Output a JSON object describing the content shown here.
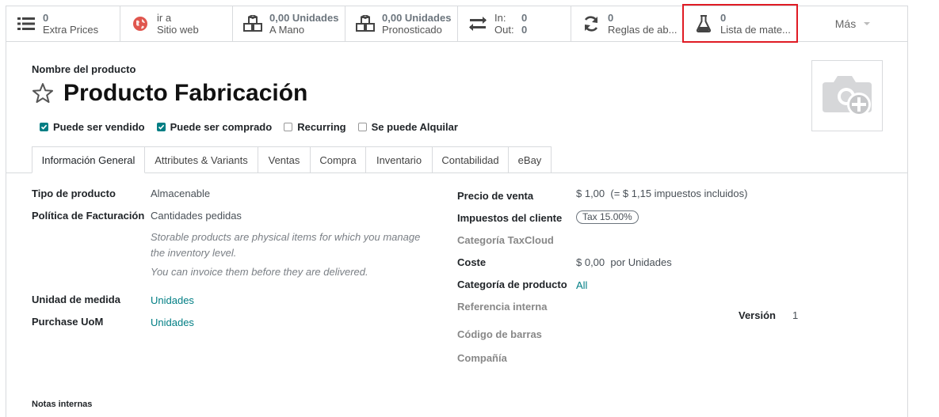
{
  "smart_buttons": {
    "extra_prices": {
      "value": "0",
      "label": "Extra Prices"
    },
    "website": {
      "value": "ir a",
      "label": "Sitio web"
    },
    "on_hand": {
      "value": "0,00 Unidades",
      "label": "A Mano"
    },
    "forecast": {
      "value": "0,00 Unidades",
      "label": "Pronosticado"
    },
    "in_out": {
      "in_label": "In:",
      "in_value": "0",
      "out_label": "Out:",
      "out_value": "0"
    },
    "reorder_rules": {
      "value": "0",
      "label": "Reglas de ab..."
    },
    "bom": {
      "value": "0",
      "label": "Lista de mate..."
    },
    "more": "Más"
  },
  "product": {
    "name_label": "Nombre del producto",
    "title": "Producto Fabricación"
  },
  "checkboxes": [
    {
      "label": "Puede ser vendido",
      "checked": true
    },
    {
      "label": "Puede ser comprado",
      "checked": true
    },
    {
      "label": "Recurring",
      "checked": false
    },
    {
      "label": "Se puede Alquilar",
      "checked": false
    }
  ],
  "tabs": [
    "Información General",
    "Attributes & Variants",
    "Ventas",
    "Compra",
    "Inventario",
    "Contabilidad",
    "eBay"
  ],
  "left_fields": {
    "product_type": {
      "label": "Tipo de producto",
      "value": "Almacenable"
    },
    "invoice_policy": {
      "label": "Política de Facturación",
      "value": "Cantidades pedidas"
    },
    "help_1": "Storable products are physical items for which you manage the inventory level.",
    "help_2": "You can invoice them before they are delivered.",
    "uom": {
      "label": "Unidad de medida",
      "value": "Unidades"
    },
    "purchase_uom": {
      "label": "Purchase UoM",
      "value": "Unidades"
    }
  },
  "right_fields": {
    "sale_price": {
      "label": "Precio de venta",
      "value": "$ 1,00",
      "extra": "(= $ 1,15 impuestos incluidos)"
    },
    "customer_taxes": {
      "label": "Impuestos del cliente",
      "value": "Tax 15.00%"
    },
    "taxcloud_category": {
      "label": "Categoría TaxCloud"
    },
    "cost": {
      "label": "Coste",
      "value": "$ 0,00",
      "extra": "por Unidades"
    },
    "product_category": {
      "label": "Categoría de producto",
      "value": "All"
    },
    "internal_ref": {
      "label": "Referencia interna"
    },
    "barcode": {
      "label": "Código de barras"
    },
    "company": {
      "label": "Compañía"
    },
    "version": {
      "label": "Versión",
      "value": "1"
    }
  },
  "notes_label": "Notas internas",
  "colors": {
    "accent": "#017e84",
    "highlight": "#e01b24"
  }
}
